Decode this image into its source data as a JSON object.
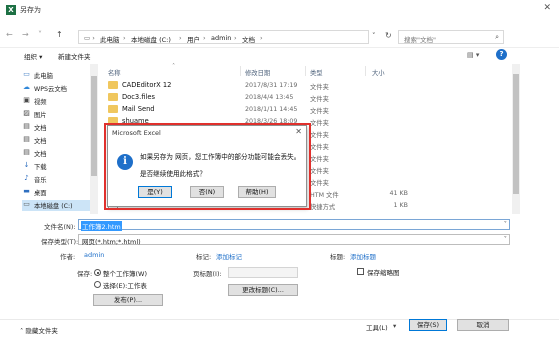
{
  "window": {
    "app_icon": "X",
    "title": "另存为",
    "close": "✕"
  },
  "nav": {
    "back": "←",
    "forward": "→",
    "recent": "˅",
    "up": "↑",
    "crumbs": [
      "此电脑",
      "本地磁盘 (C:)",
      "用户",
      "admin",
      "文档"
    ],
    "separator": "›",
    "dropdown": "˅",
    "refresh": "↻",
    "search_placeholder": "搜索\"文档\"",
    "search_icon": "⌕"
  },
  "toolbar": {
    "organize": "组织 ▾",
    "new_folder": "新建文件夹",
    "view_icon": "▤ ▾",
    "help": "?"
  },
  "sidebar": {
    "items": [
      {
        "icon": "computer-icon",
        "glyph": "▭",
        "color": "#3a79c2",
        "label": "此电脑"
      },
      {
        "icon": "cloud-icon",
        "glyph": "☁",
        "color": "#2f86d8",
        "label": "WPS云文档"
      },
      {
        "icon": "video-icon",
        "glyph": "▣",
        "color": "#4a4a4a",
        "label": "视频"
      },
      {
        "icon": "picture-icon",
        "glyph": "▨",
        "color": "#4a4a4a",
        "label": "图片"
      },
      {
        "icon": "document-icon",
        "glyph": "▤",
        "color": "#4a4a4a",
        "label": "文档"
      },
      {
        "icon": "document-icon",
        "glyph": "▤",
        "color": "#4a4a4a",
        "label": "文档"
      },
      {
        "icon": "document-icon",
        "glyph": "▤",
        "color": "#4a4a4a",
        "label": "文档"
      },
      {
        "icon": "download-icon",
        "glyph": "↓",
        "color": "#2f6fc0",
        "label": "下载"
      },
      {
        "icon": "music-icon",
        "glyph": "♪",
        "color": "#2f6fc0",
        "label": "音乐"
      },
      {
        "icon": "desktop-icon",
        "glyph": "▬",
        "color": "#2f6fc0",
        "label": "桌面"
      },
      {
        "icon": "drive-icon",
        "glyph": "▭",
        "color": "#555555",
        "label": "本地磁盘 (C:)"
      }
    ],
    "selected_index": 10
  },
  "filelist": {
    "sort_arrow": "˄",
    "columns": {
      "name": "名称",
      "date": "修改日期",
      "type": "类型",
      "size": "大小"
    },
    "rows": [
      {
        "kind": "folder",
        "name": "CADEditorX 12",
        "date": "2017/8/31 17:19",
        "type": "文件夹",
        "size": ""
      },
      {
        "kind": "folder",
        "name": "Doc3.files",
        "date": "2018/4/4 13:45",
        "type": "文件夹",
        "size": ""
      },
      {
        "kind": "folder",
        "name": "Mail Send",
        "date": "2018/1/11 14:45",
        "type": "文件夹",
        "size": ""
      },
      {
        "kind": "folder",
        "name": "shuame",
        "date": "2018/3/26 18:09",
        "type": "文件夹",
        "size": ""
      },
      {
        "kind": "folder",
        "name": "",
        "date": "",
        "type": "文件夹",
        "size": ""
      },
      {
        "kind": "folder",
        "name": "",
        "date": "",
        "type": "文件夹",
        "size": ""
      },
      {
        "kind": "folder",
        "name": "",
        "date": "",
        "type": "文件夹",
        "size": ""
      },
      {
        "kind": "folder",
        "name": "",
        "date": "",
        "type": "文件夹",
        "size": ""
      },
      {
        "kind": "folder",
        "name": "",
        "date": "",
        "type": "文件夹",
        "size": ""
      },
      {
        "kind": "html",
        "name": "",
        "date": "",
        "type": "HTM 文件",
        "size": "41 KB"
      },
      {
        "kind": "html",
        "name": "",
        "date": "",
        "type": "快捷方式",
        "size": "1 KB"
      }
    ]
  },
  "form": {
    "filename_label": "文件名(N):",
    "filename_value": "工作簿2.htm",
    "filetype_label": "保存类型(T):",
    "filetype_value": "网页(*.htm;*.html)",
    "author_label": "作者:",
    "author_value": "admin",
    "tags_label": "标记:",
    "tags_value": "添加标记",
    "title_label": "标题:",
    "title_value": "添加标题",
    "save_label": "保存:",
    "entire_workbook": "整个工作簿(W)",
    "selection": "选择(E):工作表",
    "page_title_label": "页标题(I):",
    "publish_button": "发布(P)...",
    "change_title_button": "更改标题(C)...",
    "save_thumbnail": "保存缩略图",
    "dropdown": "˅"
  },
  "footer": {
    "hide_folders": "˄ 隐藏文件夹",
    "tools": "工具(L)",
    "tools_dd": "▾",
    "save": "保存(S)",
    "cancel": "取消"
  },
  "dialog": {
    "title": "Microsoft Excel",
    "close": "✕",
    "info_glyph": "i",
    "message1": "如果另存为 网页，您工作簿中的部分功能可能会丢失。",
    "message2": "是否继续使用此格式？",
    "yes": "是(Y)",
    "no": "否(N)",
    "help": "帮助(H)"
  },
  "colors": {
    "accent": "#1e6fc9",
    "highlight_border": "#e0302c",
    "selection": "#cce4f7"
  }
}
